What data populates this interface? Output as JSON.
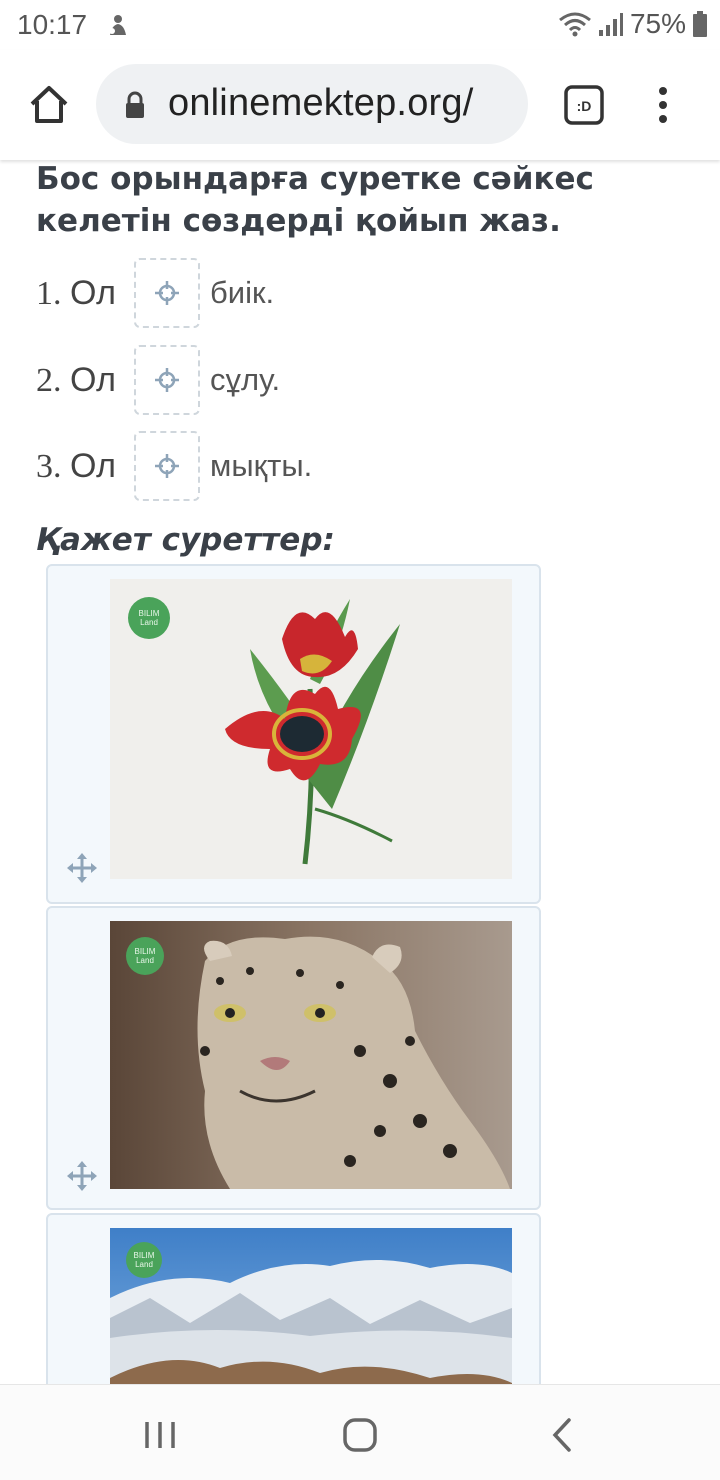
{
  "status_bar": {
    "time": "10:17",
    "battery": "75%"
  },
  "browser": {
    "url": "onlinemektep.org/"
  },
  "exercise": {
    "instruction": "Бос орындарға суретке сәйкес келетін сөздерді қойып жаз.",
    "questions": [
      {
        "number": "1.",
        "subject": "Ол",
        "ending": "биік."
      },
      {
        "number": "2.",
        "subject": "Ол",
        "ending": "сұлу."
      },
      {
        "number": "3.",
        "subject": "Ол",
        "ending": "мықты."
      }
    ],
    "images_heading": "Қажет суреттер:",
    "image_cards": [
      {
        "subject": "tulip-flower-image"
      },
      {
        "subject": "snow-leopard-image"
      },
      {
        "subject": "snowy-mountains-image"
      }
    ],
    "logo_text": "BILIM Land"
  },
  "colors": {
    "heading": "#3a4048",
    "card_bg": "#f3f8fc",
    "card_border": "#d9e3ec",
    "drop_border": "#cfd6dc",
    "icon": "#8ea4b8",
    "logo_green": "#4aa35a"
  }
}
